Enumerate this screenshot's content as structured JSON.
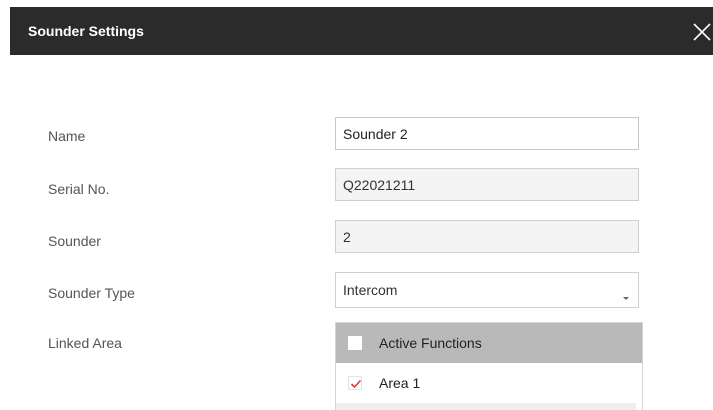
{
  "dialog": {
    "title": "Sounder Settings",
    "close_icon": "close-icon"
  },
  "form": {
    "name": {
      "label": "Name",
      "value": "Sounder 2"
    },
    "serial": {
      "label": "Serial No.",
      "value": "Q22021211"
    },
    "sounder": {
      "label": "Sounder",
      "value": "2"
    },
    "sounder_type": {
      "label": "Sounder Type",
      "value": "Intercom",
      "caret_icon": "caret-down-icon"
    },
    "linked_area": {
      "label": "Linked Area",
      "header": {
        "label": "Active Functions",
        "checked": false
      },
      "items": [
        {
          "label": "Area 1",
          "checked": true
        }
      ]
    }
  },
  "colors": {
    "titlebar": "#2b2b2b",
    "check_mark": "#e0393e",
    "list_header": "#b9b9b9"
  }
}
